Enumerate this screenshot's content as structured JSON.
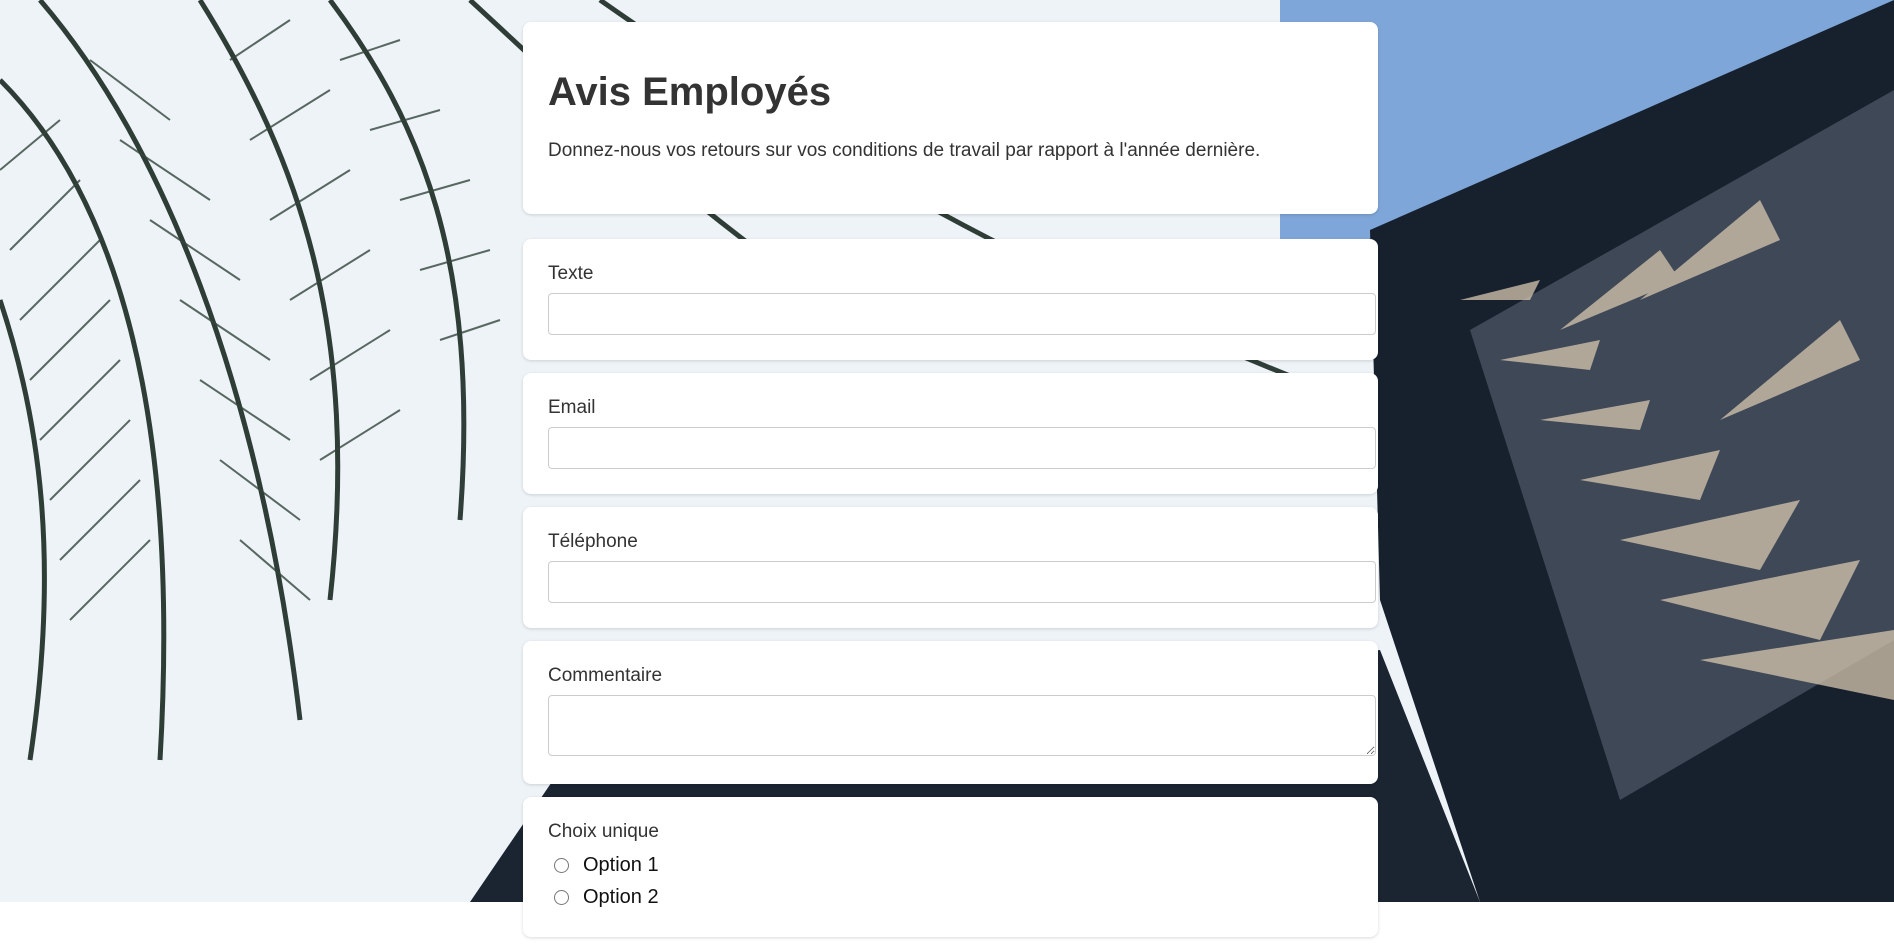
{
  "header": {
    "title": "Avis Employés",
    "description": "Donnez-nous vos retours sur vos conditions de travail par rapport à l'année dernière."
  },
  "fields": [
    {
      "label": "Texte",
      "value": "",
      "placeholder": ""
    },
    {
      "label": "Email",
      "value": "",
      "placeholder": ""
    },
    {
      "label": "Téléphone",
      "value": "",
      "placeholder": ""
    }
  ],
  "comment": {
    "label": "Commentaire",
    "value": ""
  },
  "single_choice": {
    "label": "Choix unique",
    "options": [
      "Option 1",
      "Option 2"
    ]
  }
}
